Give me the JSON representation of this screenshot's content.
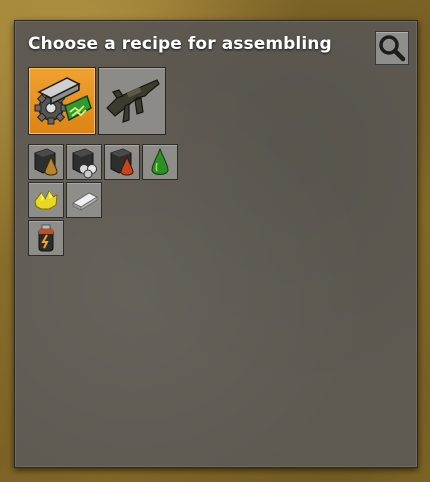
{
  "window": {
    "title": "Choose a recipe for assembling"
  },
  "toolbar": {
    "search_icon": "magnifier-icon"
  },
  "groups": [
    {
      "icon": "intermediate-products-icon",
      "selected": true
    },
    {
      "icon": "combat-rifle-icon",
      "selected": false
    }
  ],
  "recipes": [
    [
      {
        "icon": "heavy-oil-barrel-icon"
      },
      {
        "icon": "coal-liquefaction-icon"
      },
      {
        "icon": "petroleum-barrel-icon"
      },
      {
        "icon": "lubricant-icon"
      }
    ],
    [
      {
        "icon": "sulfur-icon"
      },
      {
        "icon": "plastic-bar-icon"
      }
    ],
    [
      {
        "icon": "battery-icon"
      }
    ]
  ],
  "colors": {
    "selected_tab": "#e8911f",
    "panel": "#5e5a52",
    "slot": "#8e8d89"
  }
}
